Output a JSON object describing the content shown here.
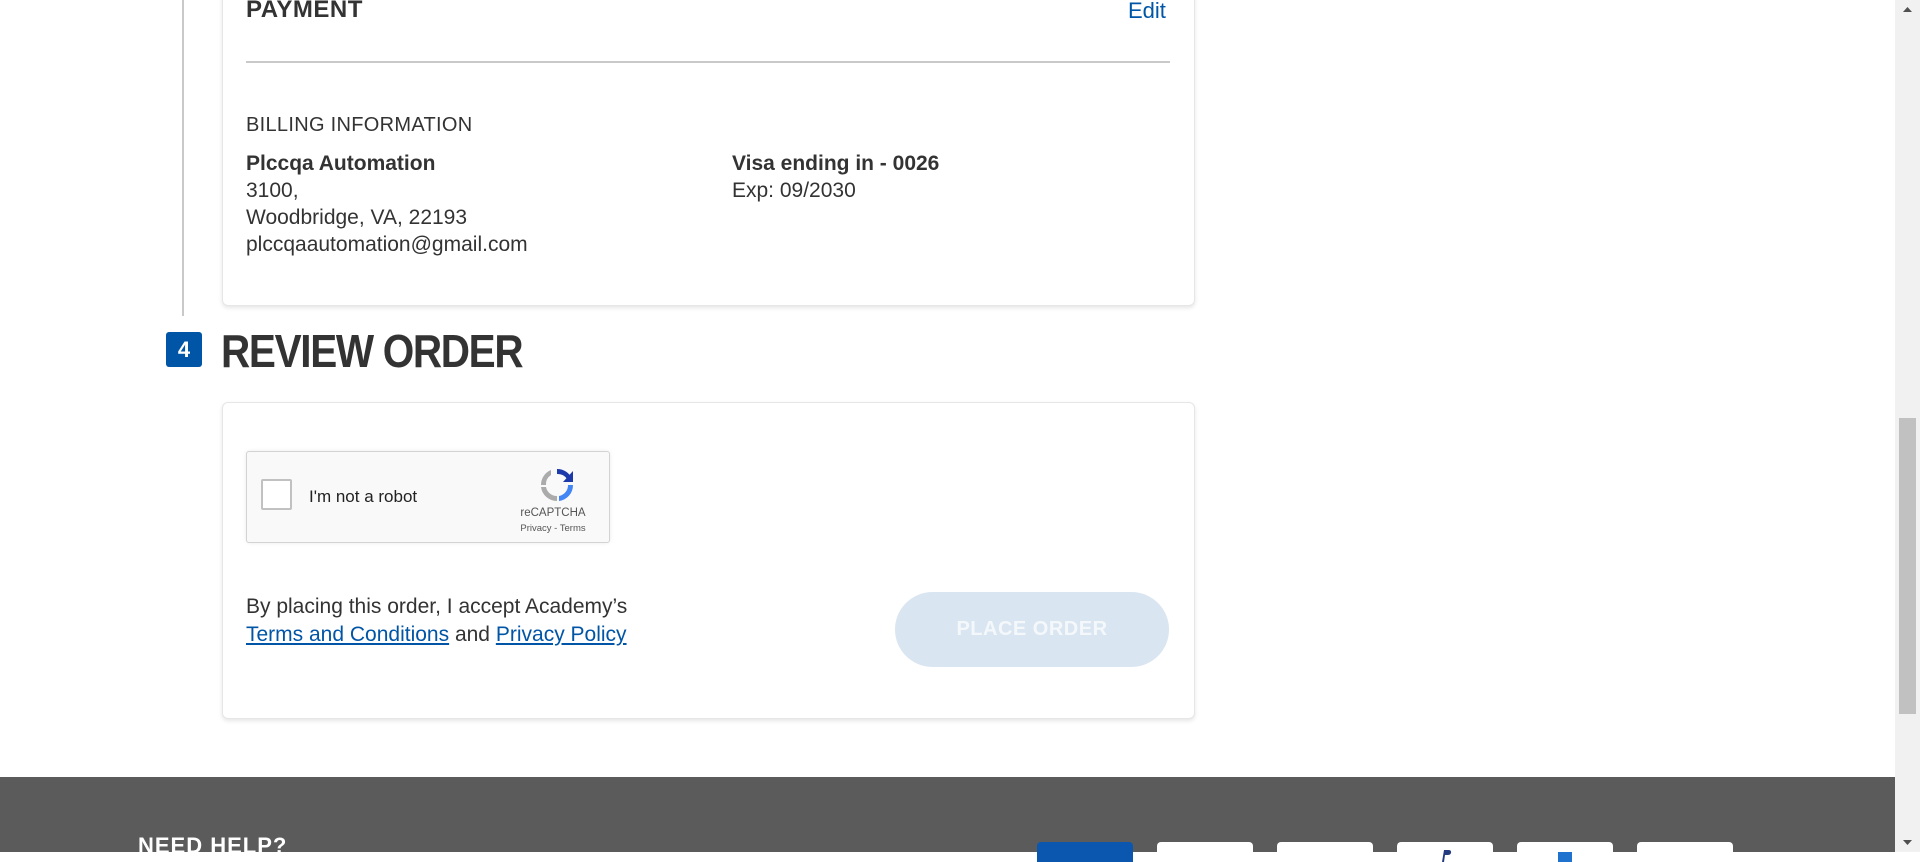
{
  "payment": {
    "title": "PAYMENT",
    "edit_label": "Edit",
    "billing_label": "BILLING INFORMATION",
    "address": {
      "name": "Plccqa Automation",
      "line1": "3100,",
      "line2": "Woodbridge, VA, 22193",
      "email": "plccqaautomation@gmail.com"
    },
    "card": {
      "title": "Visa ending in - 0026",
      "expiry": "Exp: 09/2030"
    }
  },
  "review": {
    "step_number": "4",
    "title": "REVIEW ORDER",
    "recaptcha": {
      "label": "I'm not a robot",
      "brand": "reCAPTCHA",
      "links": "Privacy - Terms"
    },
    "terms_prefix": "By placing this order, I accept Academy’s",
    "terms_link": "Terms and Conditions",
    "terms_and": "and",
    "privacy_link": "Privacy Policy",
    "place_order_label": "PLACE ORDER"
  },
  "footer": {
    "help_title": "NEED HELP?"
  },
  "colors": {
    "accent": "#0055a6",
    "place_order_disabled_bg": "#d9e5f1",
    "footer_bg": "#5b5b5b"
  },
  "icons": [
    "recaptcha-logo-icon",
    "scroll-up-arrow-icon",
    "scroll-down-arrow-icon",
    "payment-card-icons"
  ]
}
